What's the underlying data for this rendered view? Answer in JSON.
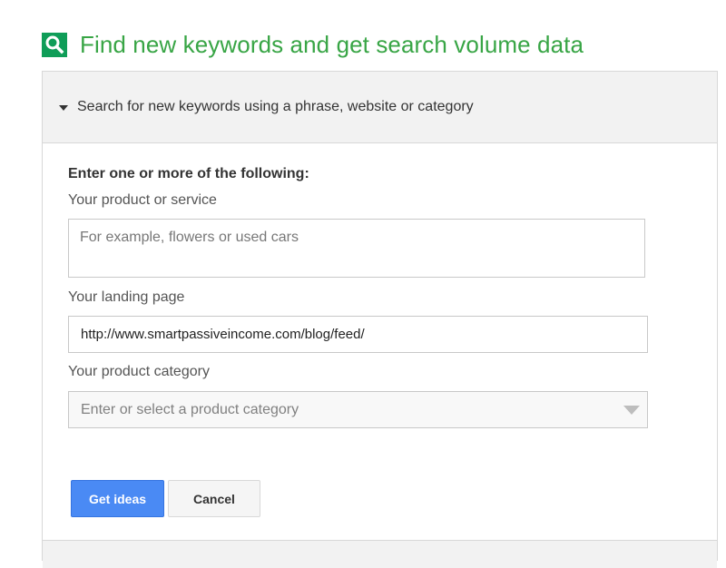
{
  "header": {
    "title": "Find new keywords and get search volume data",
    "icon": "search-icon",
    "accent_color": "#38a545"
  },
  "panel": {
    "section_title": "Search for new keywords using a phrase, website or category",
    "intro": "Enter one or more of the following:",
    "product": {
      "label": "Your product or service",
      "placeholder": "For example, flowers or used cars",
      "value": ""
    },
    "landing": {
      "label": "Your landing page",
      "value": "http://www.smartpassiveincome.com/blog/feed/"
    },
    "category": {
      "label": "Your product category",
      "placeholder": "Enter or select a product category"
    },
    "buttons": {
      "get_ideas": "Get ideas",
      "cancel": "Cancel"
    }
  },
  "colors": {
    "primary_button": "#4a8af4",
    "header_bg": "#f2f2f2"
  }
}
